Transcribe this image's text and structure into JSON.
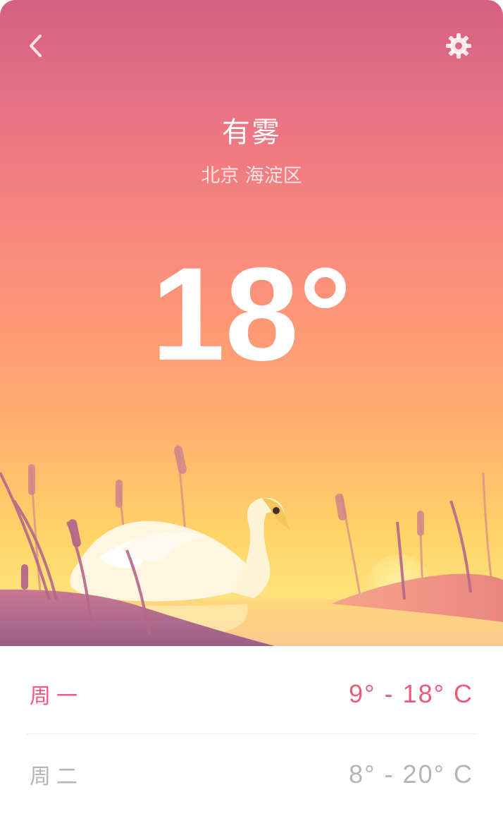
{
  "header": {
    "back_icon": "chevron-left-icon",
    "settings_icon": "gear-icon"
  },
  "weather": {
    "condition": "有雾",
    "location": "北京 海淀区",
    "temperature": "18°"
  },
  "forecast": [
    {
      "day": "周一",
      "range": "9° - 18° C",
      "highlighted": true
    },
    {
      "day": "周二",
      "range": "8° - 20° C",
      "highlighted": false
    }
  ],
  "colors": {
    "gradient_top": "#d55f82",
    "gradient_bottom": "#ffd98d",
    "accent": "#ee5a7a",
    "muted": "#b5b5b5"
  }
}
